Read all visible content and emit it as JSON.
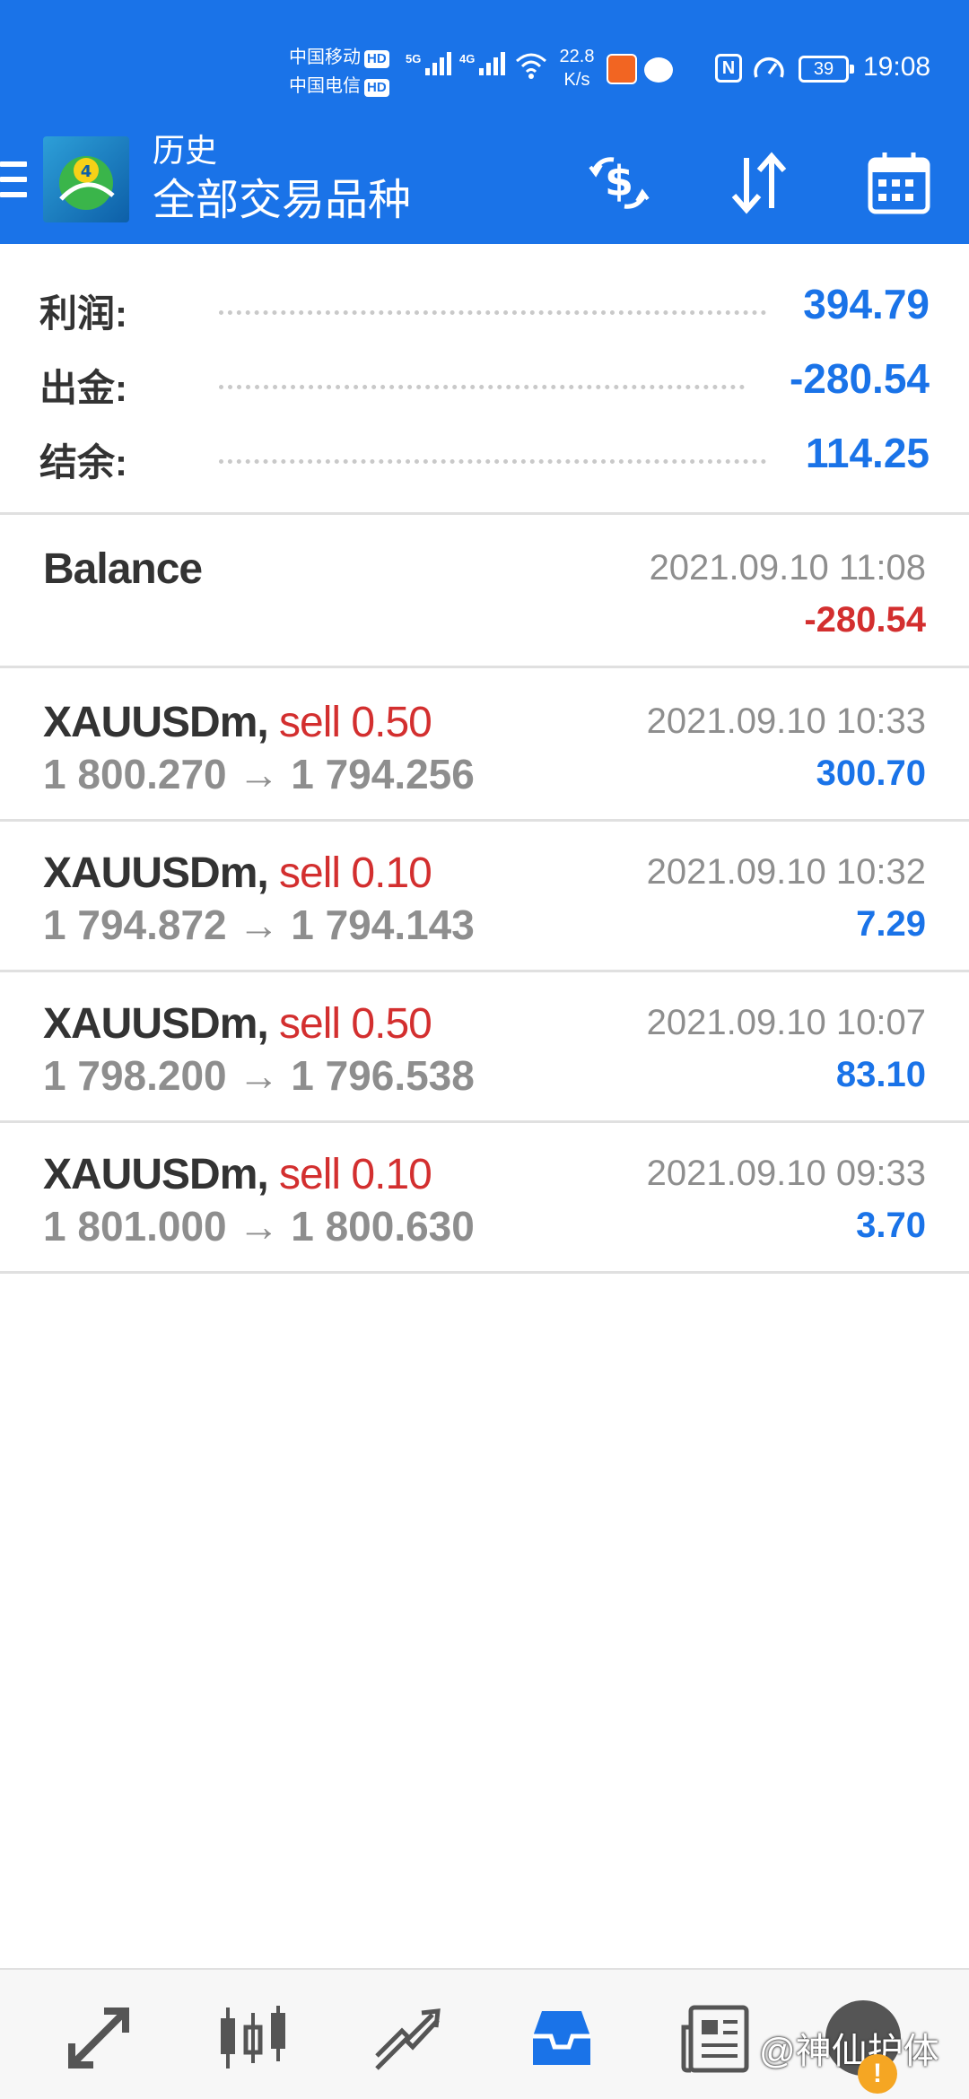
{
  "status_bar": {
    "carrier1": "中国移动",
    "carrier2": "中国电信",
    "hd": "HD",
    "net1": "5G",
    "net2": "4G",
    "speed_value": "22.8",
    "speed_unit": "K/s",
    "battery": "39",
    "time": "19:08"
  },
  "appbar": {
    "title": "历史",
    "subtitle": "全部交易品种"
  },
  "summary": [
    {
      "label": "利润:",
      "value": "394.79"
    },
    {
      "label": "出金:",
      "value": "-280.54"
    },
    {
      "label": "结余:",
      "value": "114.25"
    }
  ],
  "balance": {
    "title": "Balance",
    "date": "2021.09.10 11:08",
    "amount": "-280.54"
  },
  "deals": [
    {
      "symbol": "XAUUSDm,",
      "direction": "sell 0.50",
      "price": "1 800.270 → 1 794.256",
      "date": "2021.09.10 10:33",
      "profit": "300.70"
    },
    {
      "symbol": "XAUUSDm,",
      "direction": "sell 0.10",
      "price": "1 794.872 → 1 794.143",
      "date": "2021.09.10 10:32",
      "profit": "7.29"
    },
    {
      "symbol": "XAUUSDm,",
      "direction": "sell 0.50",
      "price": "1 798.200 → 1 796.538",
      "date": "2021.09.10 10:07",
      "profit": "83.10"
    },
    {
      "symbol": "XAUUSDm,",
      "direction": "sell 0.10",
      "price": "1 801.000 → 1 800.630",
      "date": "2021.09.10 09:33",
      "profit": "3.70"
    }
  ],
  "bottom_nav": [
    {
      "icon": "quotes-icon"
    },
    {
      "icon": "chart-icon"
    },
    {
      "icon": "trade-icon"
    },
    {
      "icon": "history-icon",
      "active": true
    },
    {
      "icon": "news-icon"
    },
    {
      "icon": "messages-icon"
    }
  ],
  "watermark": {
    "text": "@神仙护体"
  },
  "colors": {
    "primary": "#1a73e8",
    "negative": "#d32f2f",
    "muted": "#8e8e8e",
    "text": "#333333"
  }
}
